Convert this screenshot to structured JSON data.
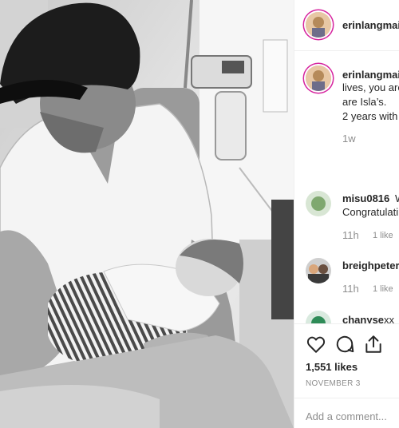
{
  "post": {
    "author_handle": "erinlangmaid",
    "caption_line1_lead": "erinlangmaid",
    "caption_line2": "lives, you are",
    "caption_line3": "are Isla’s.",
    "caption_line4": "2 years with",
    "caption_age": "1w"
  },
  "comments": [
    {
      "handle": "misu0816",
      "text_inline": "W",
      "text_line2": "Congratulati",
      "age": "11h",
      "likes": "1 like"
    },
    {
      "handle": "breighpeters",
      "age": "11h",
      "likes": "1 like"
    },
    {
      "handle": "chanyse",
      "text_inline": "xx"
    }
  ],
  "actions": {
    "likes_count": "1,551 likes",
    "date": "NOVEMBER 3",
    "comment_placeholder": "Add a comment..."
  },
  "icons": [
    "heart-icon",
    "comment-icon",
    "share-icon"
  ],
  "colors": {
    "text": "#262626",
    "muted": "#8e8e8e",
    "story_ring": "#d6249f",
    "border": "#efefef"
  }
}
